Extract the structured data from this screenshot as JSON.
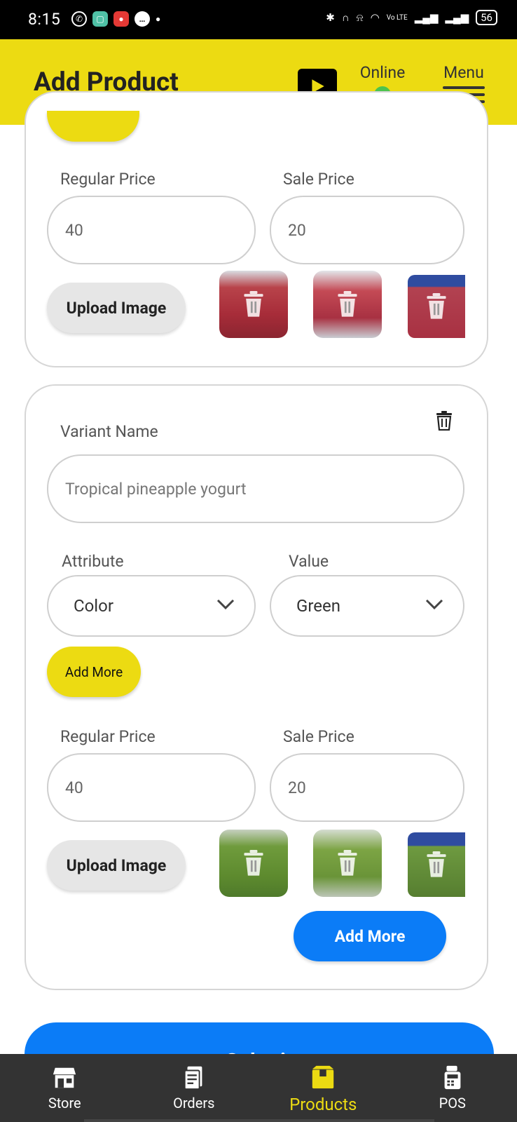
{
  "status_bar": {
    "time": "8:15",
    "battery": "56",
    "network": "Vo LTE"
  },
  "header": {
    "title": "Add Product",
    "online_label": "Online",
    "menu_label": "Menu"
  },
  "variant_1": {
    "regular_price_label": "Regular Price",
    "sale_price_label": "Sale Price",
    "regular_price_value": "40",
    "sale_price_value": "20",
    "upload_label": "Upload Image"
  },
  "variant_2": {
    "variant_name_label": "Variant Name",
    "variant_name_placeholder": "Tropical pineapple yogurt",
    "attribute_label": "Attribute",
    "value_label": "Value",
    "attribute_selected": "Color",
    "value_selected": "Green",
    "add_more_attr_label": "Add More",
    "regular_price_label": "Regular Price",
    "sale_price_label": "Sale Price",
    "regular_price_value": "40",
    "sale_price_value": "20",
    "upload_label": "Upload Image",
    "add_more_variant_label": "Add More"
  },
  "submit_label": "Submit",
  "nav": {
    "items": [
      {
        "label": "Store",
        "icon": "store-icon"
      },
      {
        "label": "Orders",
        "icon": "orders-icon"
      },
      {
        "label": "Products",
        "icon": "products-icon"
      },
      {
        "label": "POS",
        "icon": "pos-icon"
      }
    ],
    "active": "Products"
  },
  "colors": {
    "brand_yellow": "#ecdb12",
    "primary_blue": "#0b7cf7",
    "nav_bg": "#333333",
    "online_green": "#4cc34e"
  }
}
